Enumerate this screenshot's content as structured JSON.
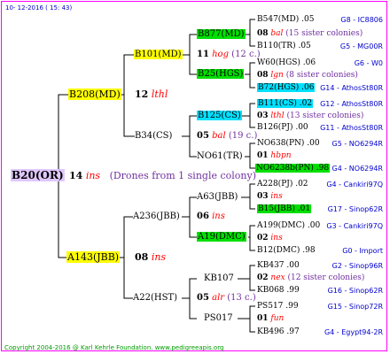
{
  "date": "10- 12-2016 ( 15: 43)",
  "copyright": "Copyright 2004-2016 @ Karl Kehrle Foundation.   www.pedigreeapis.org",
  "root": {
    "name": "B20(OR)",
    "year": "14",
    "origin": "ins",
    "note": "(Drones from 1 single colony)"
  },
  "q1": {
    "name": "B208(MD)",
    "year": "12",
    "origin": "lthl"
  },
  "q2": {
    "name": "A143(JBB)",
    "year": "08",
    "origin": "ins"
  },
  "q1a": {
    "name": "B101(MD)",
    "year": "11",
    "origin": "hog",
    "note": "(12 c.)"
  },
  "q1b": {
    "name": "B34(CS)",
    "year": "05",
    "origin": "bal",
    "note": "(19 c.)"
  },
  "q2a": {
    "name": "A236(JBB)",
    "year": "06",
    "origin": "ins"
  },
  "q2b": {
    "name": "A22(HST)",
    "year": "05",
    "origin": "alr",
    "note": "(13 c.)"
  },
  "p1": {
    "father": "B877(MD)",
    "mother": "B25(HGS)"
  },
  "p2": {
    "father": "B125(CS)",
    "mother": "NO61(TR)"
  },
  "p3": {
    "father": "A63(JBB)",
    "mother": "A19(DMC)"
  },
  "p4": {
    "father": "KB107",
    "mother": "PS017"
  },
  "leaf": [
    {
      "a": "B547(MD) .05",
      "ac": "G8 - IC8806",
      "y": "08",
      "o": "bal",
      "n": "(15 sister colonies)",
      "b": "B110(TR) .05",
      "bc": "G5 - MG00R"
    },
    {
      "a": "W60(HGS) .06",
      "ac": "G6 - W0",
      "y": "08",
      "o": "lgn",
      "n": "(8 sister colonies)",
      "b": "B72(HGS) .06",
      "bc": "G14 - AthosSt80R"
    },
    {
      "a": "B111(CS) .02",
      "ac": "G12 - AthosSt80R",
      "y": "03",
      "o": "lthl",
      "n": "(13 sister colonies)",
      "b": "B126(PJ) .00",
      "bc": "G11 - AthosSt80R"
    },
    {
      "a": "NO638(PN) .00",
      "ac": "G5 - NO6294R",
      "y": "01",
      "o": "hbpn",
      "n": "",
      "b": "NO6238b(PN) .98",
      "bc": "G4 - NO6294R"
    },
    {
      "a": "A228(PJ) .02",
      "ac": "G4 - Cankiri97Q",
      "y": "03",
      "o": "ins",
      "n": "",
      "b": "B15(JBB) .01",
      "bc": "G17 - Sinop62R"
    },
    {
      "a": "A199(DMC) .00",
      "ac": "G3 - Cankiri97Q",
      "y": "02",
      "o": "ins",
      "n": "",
      "b": "B12(DMC) .98",
      "bc": "G0 - Import"
    },
    {
      "a": "KB437 .00",
      "ac": "G2 - Sinop96R",
      "y": "02",
      "o": "nex",
      "n": "(12 sister colonies)",
      "b": "KB068 .99",
      "bc": "G16 - Sinop62R"
    },
    {
      "a": "PS517 .99",
      "ac": "G15 - Sinop72R",
      "y": "01",
      "o": "fun",
      "n": "",
      "b": "KB496 .97",
      "bc": "G4 - Egypt94-2R"
    }
  ]
}
